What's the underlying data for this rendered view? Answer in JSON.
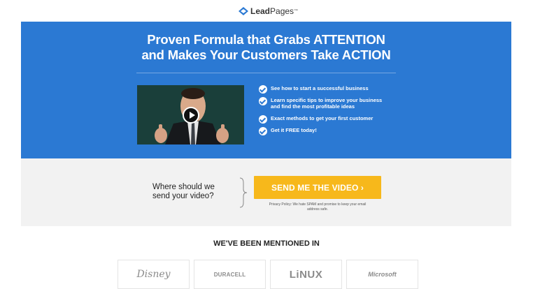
{
  "header": {
    "logo_text_bold": "Lead",
    "logo_text_light": "Pages",
    "logo_mark": "™",
    "logo_icon": "leadpages-logo-icon",
    "accent": "#2b79d3"
  },
  "hero": {
    "title_line1": "Proven Formula that Grabs ATTENTION",
    "title_line2": "and Makes Your Customers Take ACTION",
    "background": "#2b79d3",
    "video": {
      "play_icon": "play-icon"
    },
    "bullets": [
      {
        "lines": [
          "See how to start a successful business"
        ]
      },
      {
        "lines": [
          "Learn specific tips to improve your business",
          "and find the most profitable ideas"
        ]
      },
      {
        "lines": [
          "Exact methods to get your first customer"
        ]
      },
      {
        "lines": [
          "Get it FREE today!"
        ]
      }
    ]
  },
  "optin": {
    "question_line1": "Where should we",
    "question_line2": "send your video?",
    "cta_label": "SEND ME THE VIDEO ›",
    "cta_color": "#f7b81b",
    "privacy_line1": "Privacy Policy: We hate SPAM and promise to keep your email",
    "privacy_line2": "address safe."
  },
  "mentions": {
    "heading": "WE'VE BEEN MENTIONED IN",
    "logos": [
      {
        "name": "Disney"
      },
      {
        "name": "DURACELL"
      },
      {
        "name": "LiNUX"
      },
      {
        "name": "Microsoft"
      }
    ]
  }
}
